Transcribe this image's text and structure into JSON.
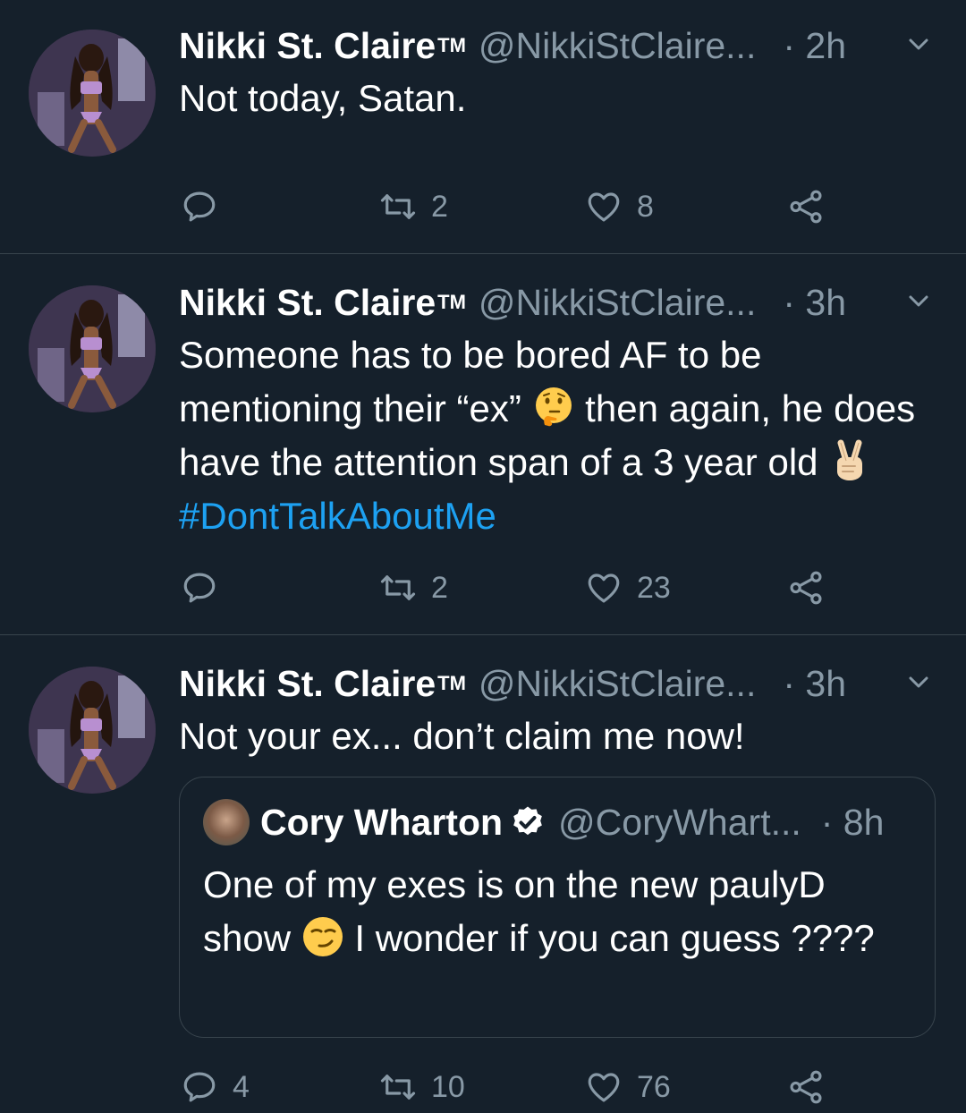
{
  "tweets": [
    {
      "name": "Nikki St. Claire",
      "tm": "TM",
      "handle": "@NikkiStClaire...",
      "time": "· 2h",
      "text": "Not today, Satan.",
      "actions": {
        "reply": "",
        "retweet": "2",
        "like": "8"
      }
    },
    {
      "name": "Nikki St. Claire",
      "tm": "TM",
      "handle": "@NikkiStClaire...",
      "time": "· 3h",
      "text_parts": [
        "Someone has to be bored AF to be mentioning their “ex” ",
        " then again, he does have the attention span of a 3 year old ",
        "#DontTalkAboutMe"
      ],
      "emojis": [
        "thinking-face-emoji",
        "victory-hand-emoji"
      ],
      "actions": {
        "reply": "",
        "retweet": "2",
        "like": "23"
      }
    },
    {
      "name": "Nikki St. Claire",
      "tm": "TM",
      "handle": "@NikkiStClaire...",
      "time": "· 3h",
      "text": "Not your ex... don’t claim me now!",
      "quote": {
        "name": "Cory Wharton",
        "handle": "@CoryWhart...",
        "time": "· 8h",
        "text_parts": [
          "One of my exes is on the new paulyD show ",
          " I wonder if you can guess ????"
        ],
        "emoji": "smirking-face-emoji"
      },
      "actions": {
        "reply": "4",
        "retweet": "10",
        "like": "76"
      }
    }
  ],
  "colors": {
    "background": "#15202b",
    "text": "#ffffff",
    "secondary": "#8899a6",
    "link": "#1da1f2",
    "divider": "#38444d"
  }
}
